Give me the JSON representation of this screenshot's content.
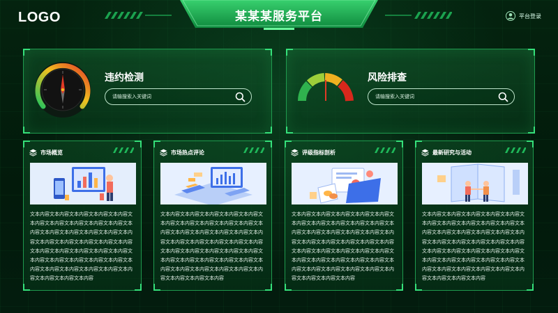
{
  "header": {
    "logo": "LOGO",
    "title": "某某某服务平台",
    "user_label": "平台登录"
  },
  "panels": [
    {
      "title": "违约检测",
      "search_placeholder": "请输搜索入关键词"
    },
    {
      "title": "风险排查",
      "search_placeholder": "请输搜索入关键词"
    }
  ],
  "cards": [
    {
      "title": "市场概览",
      "image": "analytics-illustration",
      "text": "文本内容文本内容文本内容文本内容文本内容文本内容文本内容文本内容文本内容文本内容文本内容文本内容文本内容文本内容文本内容文本内容文本内容文本内容文本内容文本内容文本内容文本内容文本内容文本内容文本内容文本内容文本内容文本内容文本内容文本内容文本内容文本内容文本内容文本内容文本内容文本内容文本内容文本内容文本内容文本内容"
    },
    {
      "title": "市场热点评论",
      "image": "dashboard-illustration",
      "text": "文本内容文本内容文本内容文本内容文本内容文本内容文本内容文本内容文本内容文本内容文本内容文本内容文本内容文本内容文本内容文本内容文本内容文本内容文本内容文本内容文本内容文本内容文本内容文本内容文本内容文本内容文本内容文本内容文本内容文本内容文本内容文本内容文本内容文本内容文本内容文本内容文本内容文本内容文本内容文本内容"
    },
    {
      "title": "评级指标剖析",
      "image": "documents-illustration",
      "text": "文本内容文本内容文本内容文本内容文本内容文本内容文本内容文本内容文本内容文本内容文本内容文本内容文本内容文本内容文本内容文本内容文本内容文本内容文本内容文本内容文本内容文本内容文本内容文本内容文本内容文本内容文本内容文本内容文本内容文本内容文本内容文本内容文本内容文本内容文本内容文本内容文本内容文本内容文本内容文本内容"
    },
    {
      "title": "最新研究与活动",
      "image": "handshake-illustration",
      "text": "文本内容文本内容文本内容文本内容文本内容文本内容文本内容文本内容文本内容文本内容文本内容文本内容文本内容文本内容文本内容文本内容文本内容文本内容文本内容文本内容文本内容文本内容文本内容文本内容文本内容文本内容文本内容文本内容文本内容文本内容文本内容文本内容文本内容文本内容文本内容文本内容文本内容文本内容文本内容文本内容"
    }
  ],
  "colors": {
    "accent": "#35e07a",
    "border": "#1f9a4e",
    "background": "#021a0c"
  }
}
